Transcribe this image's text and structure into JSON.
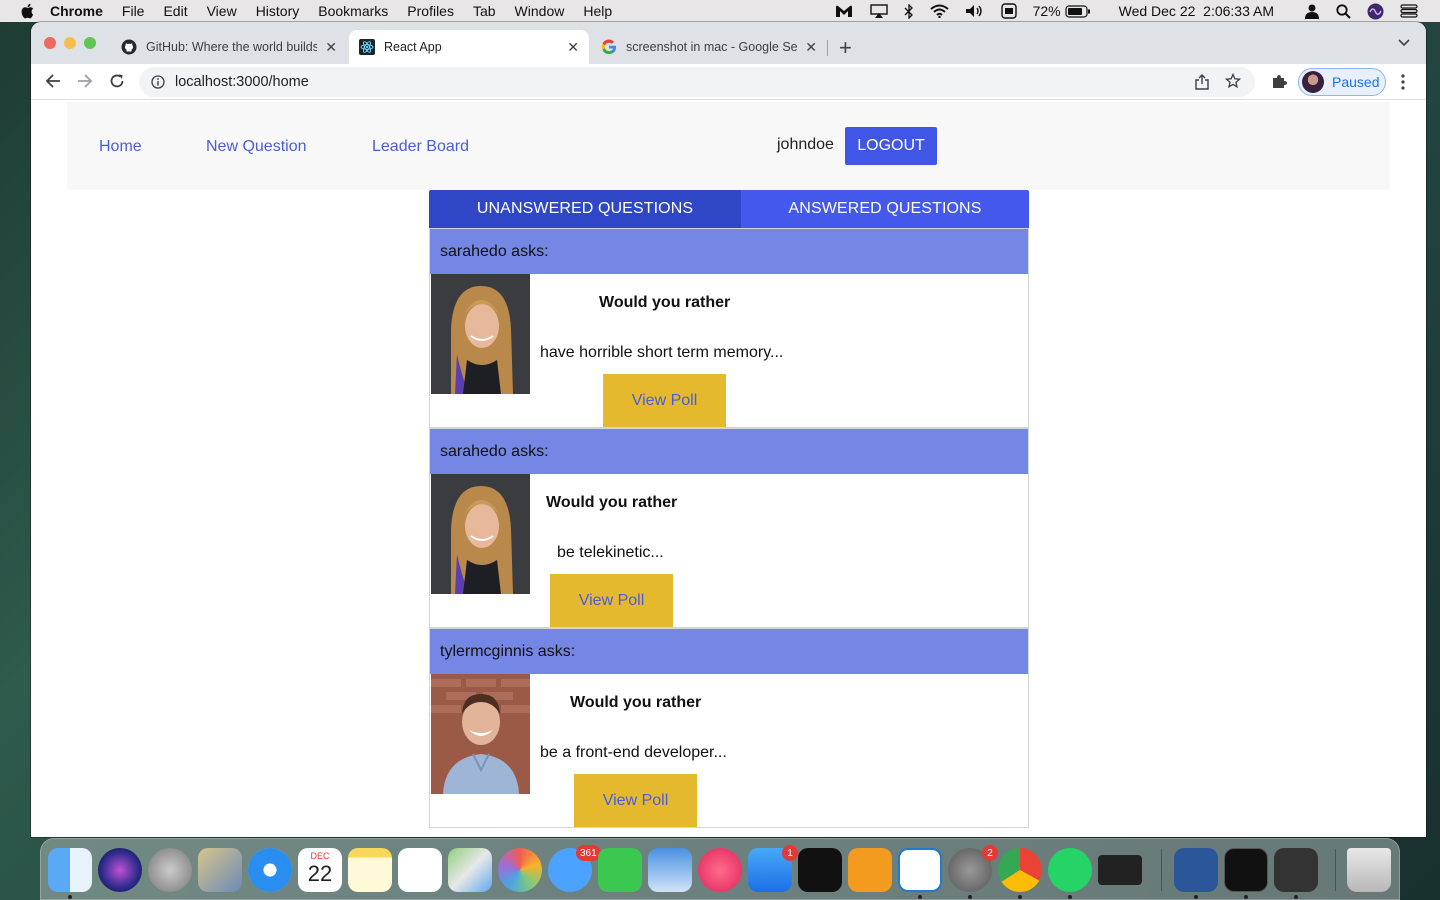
{
  "menubar": {
    "app_name": "Chrome",
    "items": [
      "File",
      "Edit",
      "View",
      "History",
      "Bookmarks",
      "Profiles",
      "Tab",
      "Window",
      "Help"
    ],
    "battery": "72%",
    "datetime": "Wed Dec 22  2:06:33 AM"
  },
  "browser": {
    "tabs": [
      {
        "label": "GitHub: Where the world builds",
        "icon": "github-icon"
      },
      {
        "label": "React App",
        "icon": "react-icon"
      },
      {
        "label": "screenshot in mac - Google Se",
        "icon": "google-icon"
      }
    ],
    "url": "localhost:3000/home",
    "profile_label": "Paused"
  },
  "app": {
    "nav": {
      "home": "Home",
      "new_question": "New Question",
      "leader_board": "Leader Board",
      "username": "johndoe",
      "logout": "LOGOUT"
    },
    "question_tabs": {
      "unanswered": "UNANSWERED QUESTIONS",
      "answered": "ANSWERED QUESTIONS"
    },
    "questions": [
      {
        "asker": "sarahedo asks:",
        "title": "Would you rather",
        "option": "have horrible short term memory...",
        "button": "View Poll"
      },
      {
        "asker": "sarahedo asks:",
        "title": "Would you rather",
        "option": "be telekinetic...",
        "button": "View Poll"
      },
      {
        "asker": "tylermcginnis asks:",
        "title": "Would you rather",
        "option": "be a front-end developer...",
        "button": "View Poll"
      }
    ]
  },
  "dock": {
    "badges": {
      "messages": "361",
      "app_store": "1",
      "system_preferences": "2"
    },
    "calendar_month": "DEC",
    "calendar_day": "22"
  },
  "colors": {
    "primary_button": "#3f56e6",
    "tab_active": "#2f47c7",
    "tab_inactive": "#4458eb",
    "card_header": "#7487e4",
    "view_poll": "#e4b92e",
    "link": "#4a5ddb"
  }
}
